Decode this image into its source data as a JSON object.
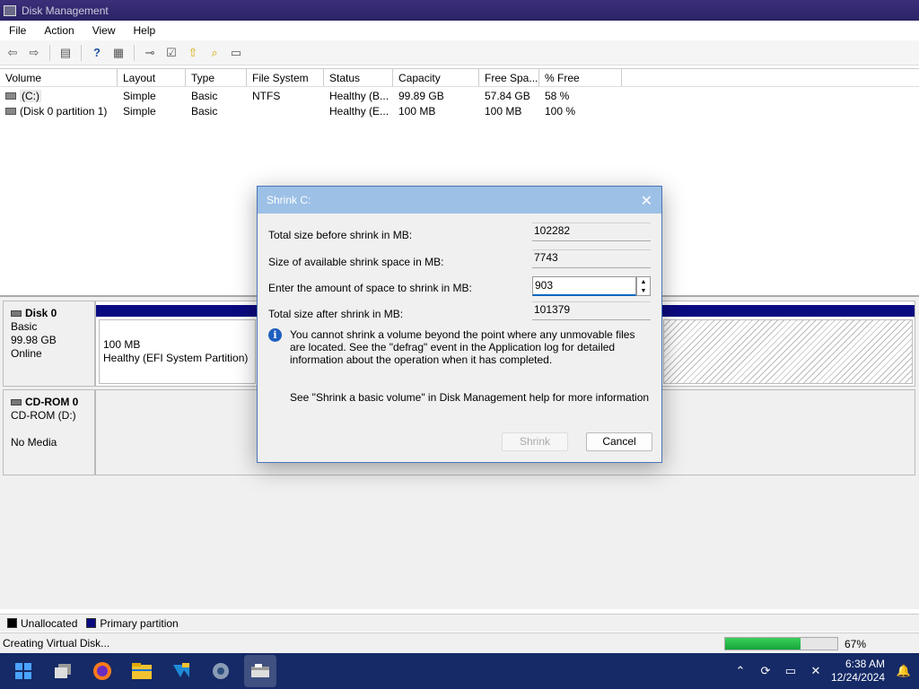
{
  "window": {
    "title": "Disk Management"
  },
  "menu": [
    "File",
    "Action",
    "View",
    "Help"
  ],
  "toolbar_icons": [
    "back-icon",
    "forward-icon",
    "properties-icon",
    "help-icon",
    "disk-list-icon",
    "connect-icon",
    "check-icon",
    "up-icon",
    "search-icon",
    "settings-icon"
  ],
  "volumes": {
    "headers": [
      "Volume",
      "Layout",
      "Type",
      "File System",
      "Status",
      "Capacity",
      "Free Spa...",
      "% Free"
    ],
    "rows": [
      [
        "(C:)",
        "Simple",
        "Basic",
        "NTFS",
        "Healthy (B...",
        "99.89 GB",
        "57.84 GB",
        "58 %"
      ],
      [
        "(Disk 0 partition 1)",
        "Simple",
        "Basic",
        "",
        "Healthy (E...",
        "100 MB",
        "100 MB",
        "100 %"
      ]
    ]
  },
  "disks": {
    "disk0": {
      "name": "Disk 0",
      "type": "Basic",
      "size": "99.98 GB",
      "state": "Online"
    },
    "efi_partition": {
      "size": "100 MB",
      "status": "Healthy (EFI System Partition)"
    },
    "cdrom": {
      "name": "CD-ROM 0",
      "type": "CD-ROM (D:)",
      "state": "No Media"
    }
  },
  "legend": [
    {
      "label": "Unallocated",
      "color": "#000000"
    },
    {
      "label": "Primary partition",
      "color": "#0a0a80"
    }
  ],
  "status": {
    "text": "Creating Virtual Disk...",
    "progress_percent": 67,
    "progress_label": "67%"
  },
  "dialog": {
    "title": "Shrink C:",
    "total_before_label": "Total size before shrink in MB:",
    "total_before_value": "102282",
    "available_label": "Size of available shrink space in MB:",
    "available_value": "7743",
    "amount_label": "Enter the amount of space to shrink in MB:",
    "amount_value": "903",
    "total_after_label": "Total size after shrink in MB:",
    "total_after_value": "101379",
    "info": "You cannot shrink a volume beyond the point where any unmovable files are located. See the \"defrag\" event in the Application log for detailed information about the operation when it has completed.",
    "help": "See \"Shrink a basic volume\" in Disk Management help for more information",
    "shrink_button": "Shrink",
    "cancel_button": "Cancel"
  },
  "taskbar": {
    "apps": [
      "start-icon",
      "task-view-icon",
      "firefox-icon",
      "file-explorer-icon",
      "vscode-icon",
      "settings-icon",
      "disk-management-icon"
    ],
    "time": "6:38 AM",
    "date": "12/24/2024"
  }
}
